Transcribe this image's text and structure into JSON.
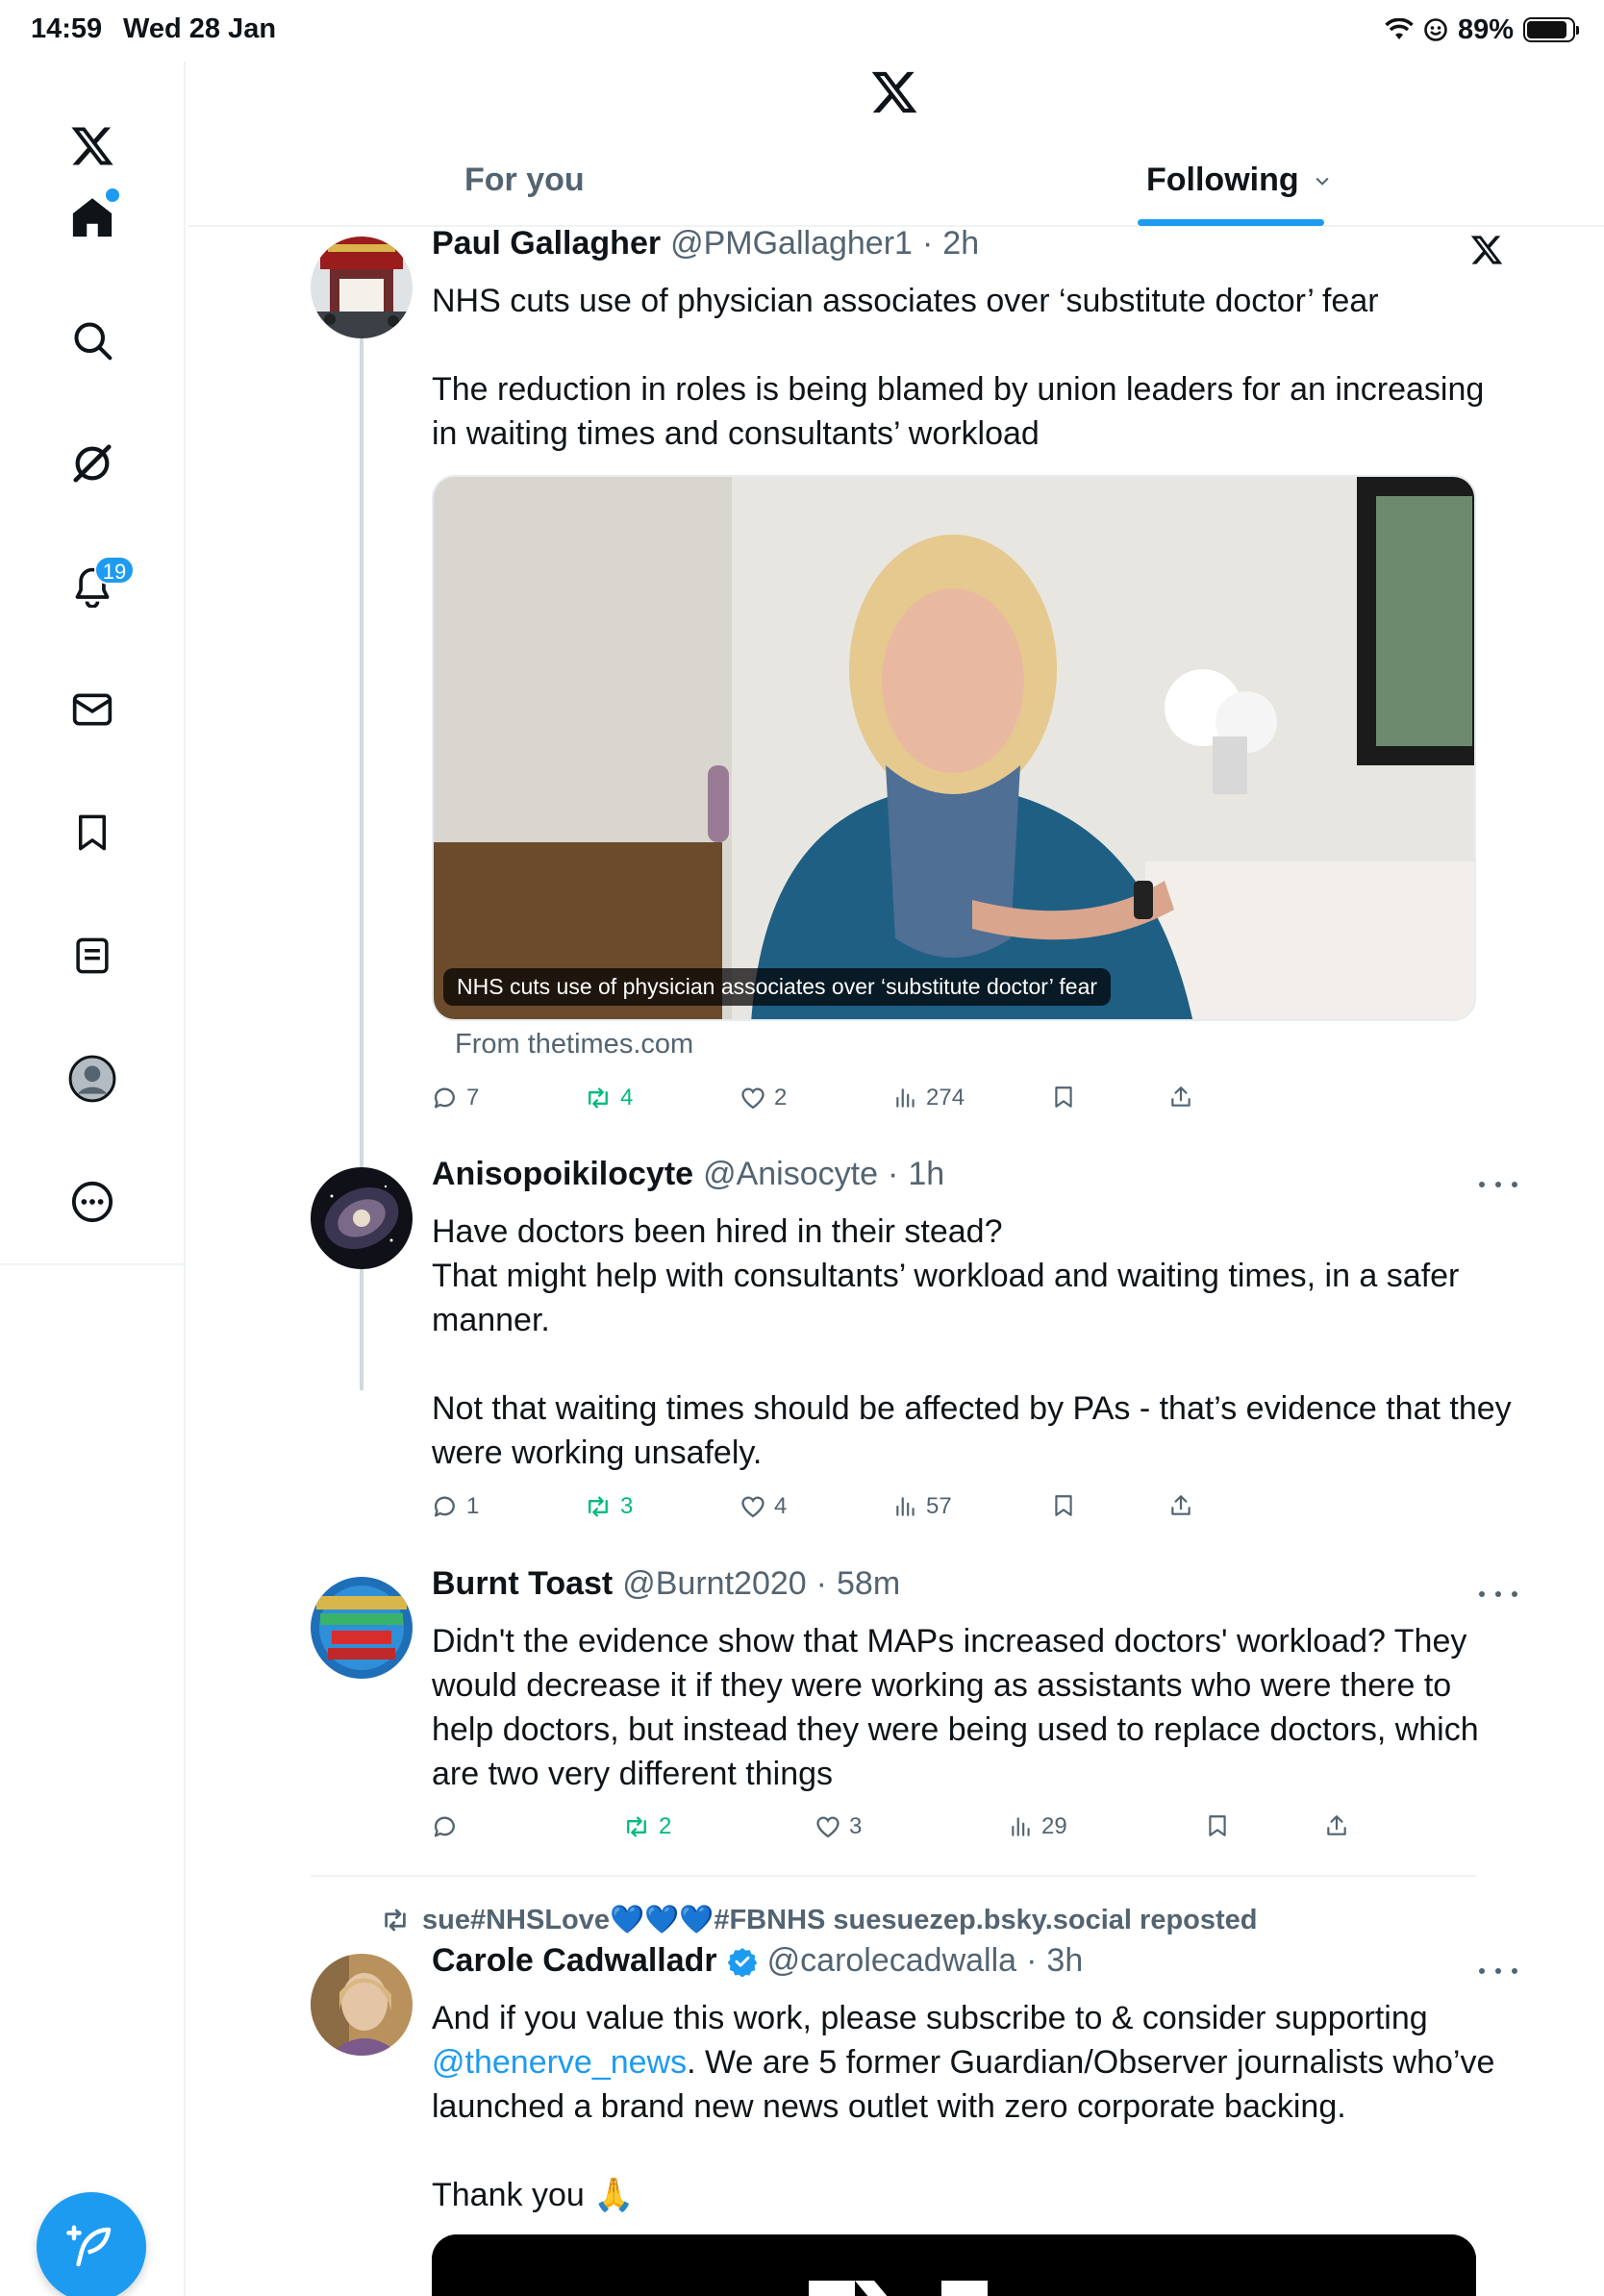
{
  "status_bar": {
    "time": "14:59",
    "date": "Wed 28 Jan",
    "battery": "89%",
    "battery_level": 0.89
  },
  "sidebar": {
    "items": [
      {
        "name": "x-logo-icon"
      },
      {
        "name": "home-icon"
      },
      {
        "name": "search-icon"
      },
      {
        "name": "grok-icon"
      },
      {
        "name": "notifications-icon"
      },
      {
        "name": "messages-icon"
      },
      {
        "name": "bookmarks-icon"
      },
      {
        "name": "lists-icon"
      },
      {
        "name": "profile-icon"
      },
      {
        "name": "more-icon"
      }
    ],
    "notification_count": "19"
  },
  "header": {
    "tabs": [
      {
        "label": "For you",
        "active": false
      },
      {
        "label": "Following",
        "active": true
      }
    ]
  },
  "accent_color": "#1d9bf0",
  "repost_color": "#00ba7c",
  "tweets": [
    {
      "name": "Paul Gallagher",
      "handle": "@PMGallagher1",
      "time": "2h",
      "text": [
        "NHS cuts use of physician associates over ‘substitute doctor’ fear",
        "",
        "The reduction in roles is being blamed by union leaders for an increasing in waiting times and consultants’ workload"
      ],
      "media_caption": "NHS cuts use of physician associates over ‘substitute doctor’ fear",
      "source": "From thetimes.com",
      "replies": "7",
      "reposts": "4",
      "likes": "2",
      "views": "274"
    },
    {
      "name": "Anisopoikilocyte",
      "handle": "@Anisocyte",
      "time": "1h",
      "text": [
        "Have doctors been hired in their stead?",
        "That might help with consultants’ workload and waiting times, in a safer manner.",
        "",
        "Not that waiting times should be affected by PAs - that’s evidence that they were working unsafely."
      ],
      "replies": "1",
      "reposts": "3",
      "likes": "4",
      "views": "57"
    },
    {
      "name": "Burnt Toast",
      "handle": "@Burnt2020",
      "time": "58m",
      "text": [
        "Didn't the evidence show that MAPs increased doctors' workload? They would decrease it if they were working as assistants who were there to help doctors, but instead they were being used to replace doctors, which are two very different things"
      ],
      "replies": "",
      "reposts": "2",
      "likes": "3",
      "views": "29"
    },
    {
      "reposted_by": "sue#NHSLove💙💙💙#FBNHS suesuezep.bsky.social reposted",
      "name": "Carole Cadwalladr",
      "handle": "@carolecadwalla",
      "time": "3h",
      "text_before_link": "And if you value this work, please subscribe to & consider supporting ",
      "link": "@thenerve_news",
      "text_after_link": ". We are 5 former Guardian/Observer journalists who’ve launched a brand new news outlet with zero corporate backing.",
      "text_end": "Thank you 🙏"
    }
  ]
}
